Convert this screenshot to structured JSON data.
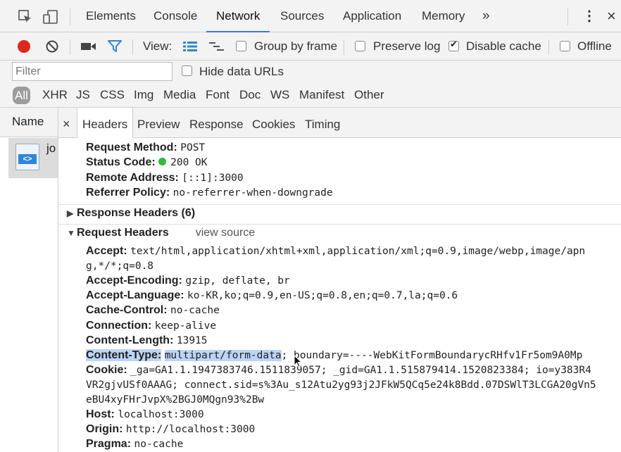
{
  "tabs": {
    "items": [
      "Elements",
      "Console",
      "Network",
      "Sources",
      "Application",
      "Memory"
    ],
    "active": "Network",
    "overflow": "»",
    "more": "⋮",
    "close": "×"
  },
  "toolbar": {
    "view_label": "View:",
    "group_by_frame": {
      "label": "Group by frame",
      "checked": false
    },
    "preserve_log": {
      "label": "Preserve log",
      "checked": false
    },
    "disable_cache": {
      "label": "Disable cache",
      "checked": true
    },
    "offline": {
      "label": "Offline",
      "checked": false
    }
  },
  "filter": {
    "placeholder": "Filter",
    "hide_data_urls": {
      "label": "Hide data URLs",
      "checked": false
    }
  },
  "types": [
    "All",
    "XHR",
    "JS",
    "CSS",
    "Img",
    "Media",
    "Font",
    "Doc",
    "WS",
    "Manifest",
    "Other"
  ],
  "name_column": {
    "header": "Name",
    "file": "jo",
    "file_icon_glyph": "<>"
  },
  "detail_tabs": {
    "close": "×",
    "items": [
      "Headers",
      "Preview",
      "Response",
      "Cookies",
      "Timing"
    ],
    "active": "Headers"
  },
  "general": [
    {
      "k": "Request Method:",
      "v": "POST"
    },
    {
      "k": "Status Code:",
      "v": "200 OK",
      "status_color": "#2dbd3a"
    },
    {
      "k": "Remote Address:",
      "v": "[::1]:3000"
    },
    {
      "k": "Referrer Policy:",
      "v": "no-referrer-when-downgrade"
    }
  ],
  "response_headers": {
    "title": "Response Headers (6)",
    "collapsed": true
  },
  "request_headers": {
    "title": "Request Headers",
    "view_source": "view source",
    "collapsed": false,
    "items": [
      {
        "k": "Accept:",
        "v": "text/html,application/xhtml+xml,application/xml;q=0.9,image/webp,image/apn",
        "cont": "g,*/*;q=0.8"
      },
      {
        "k": "Accept-Encoding:",
        "v": "gzip, deflate, br"
      },
      {
        "k": "Accept-Language:",
        "v": "ko-KR,ko;q=0.9,en-US;q=0.8,en;q=0.7,la;q=0.6"
      },
      {
        "k": "Cache-Control:",
        "v": "no-cache"
      },
      {
        "k": "Connection:",
        "v": "keep-alive"
      },
      {
        "k": "Content-Length:",
        "v": "13915"
      },
      {
        "k": "Content-Type:",
        "v_highlight": "multipart/form-data",
        "v": "; boundary=----WebKitFormBoundarycRHfv1Fr5om9A0Mp"
      },
      {
        "k": "Cookie:",
        "v": "_ga=GA1.1.1947383746.1511839057; _gid=GA1.1.515879414.1520823384; io=y383R4",
        "cont": "VR2gjvUSf0AAAG; connect.sid=s%3Au_s12Atu2yg93j2JFkW5QCq5e24k8Bdd.07DSWlT3LCGA20gVn5",
        "cont2": "eBU4xyFHrJvpX%2BGJ0MQgn93%2Bw"
      },
      {
        "k": "Host:",
        "v": "localhost:3000"
      },
      {
        "k": "Origin:",
        "v": "http://localhost:3000"
      },
      {
        "k": "Pragma:",
        "v": "no-cache"
      }
    ]
  },
  "colors": {
    "accent": "#3a78e0",
    "record": "#e0261b",
    "filter_icon": "#2f86d6",
    "highlight": "#bcd4f6"
  }
}
